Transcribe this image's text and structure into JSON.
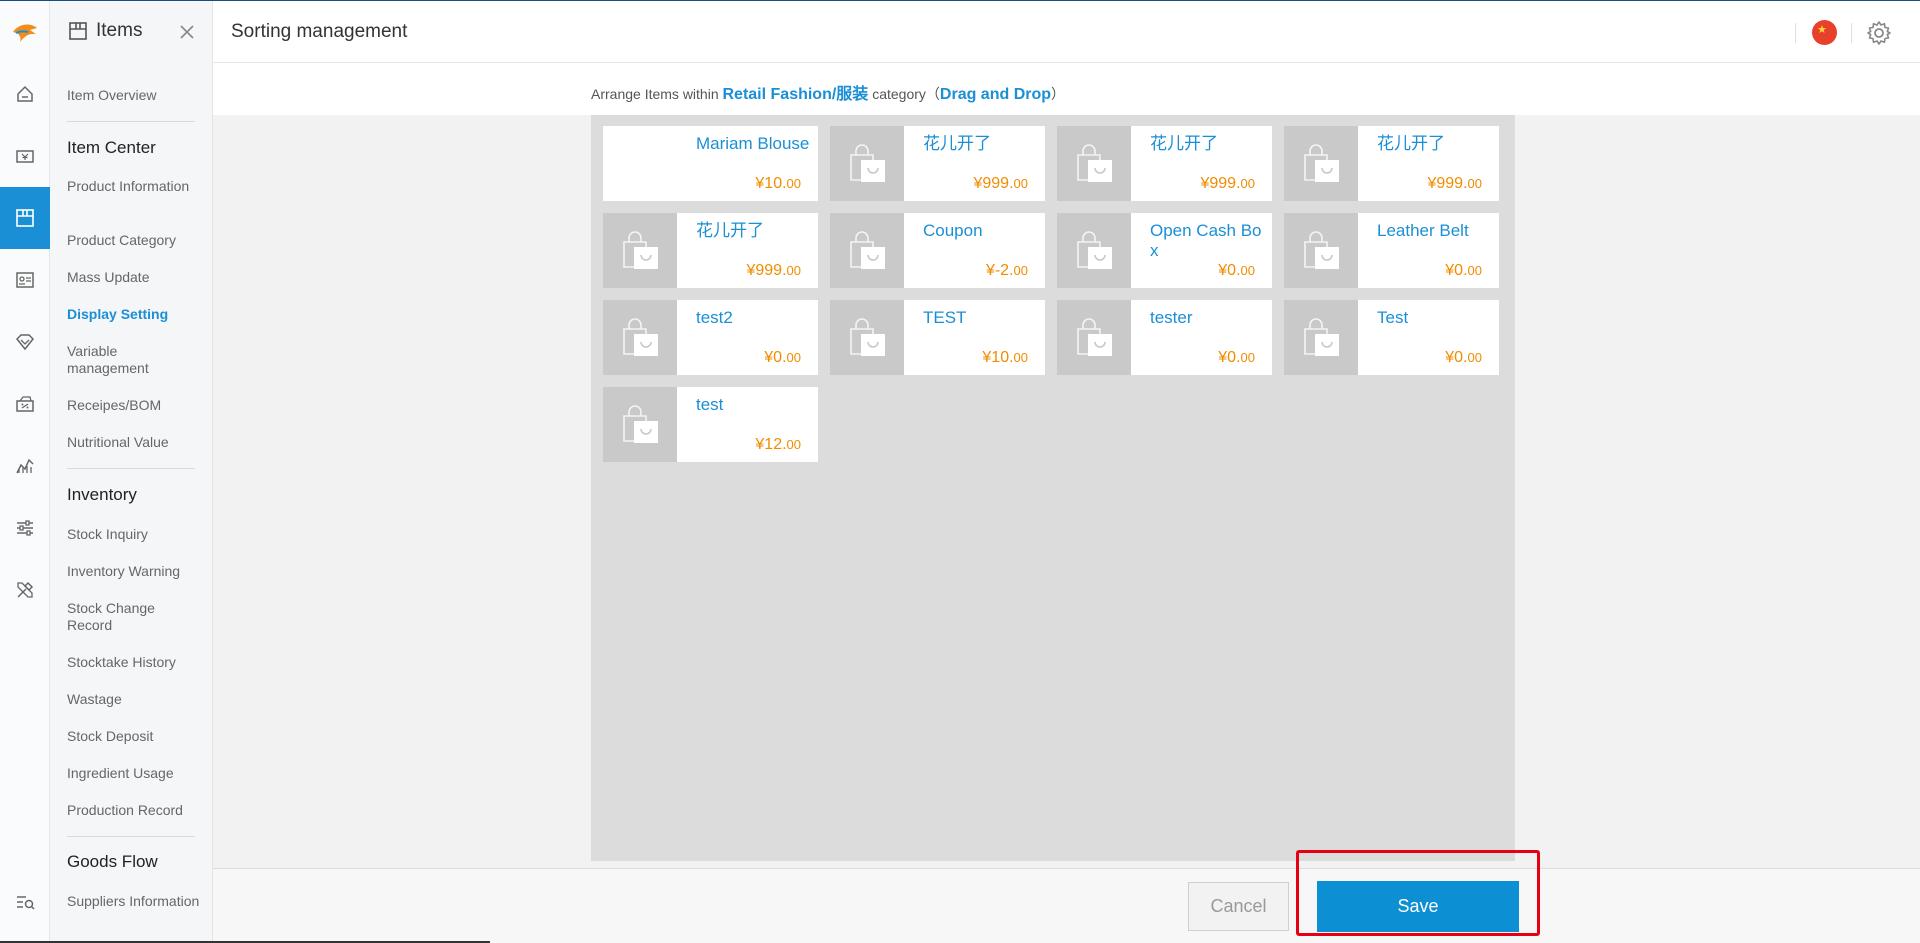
{
  "app": {
    "logo_icon": "app-logo-icon",
    "accent_color": "#1a8fd6",
    "price_color": "#f08c00"
  },
  "rail": [
    {
      "name": "home",
      "icon": "home-icon",
      "active": false
    },
    {
      "name": "sales",
      "icon": "cash-register-icon",
      "active": false
    },
    {
      "name": "items",
      "icon": "box-icon",
      "active": true
    },
    {
      "name": "members",
      "icon": "member-card-icon",
      "active": false
    },
    {
      "name": "marketing",
      "icon": "diamond-icon",
      "active": false
    },
    {
      "name": "promotions",
      "icon": "coupon-icon",
      "active": false
    },
    {
      "name": "reports",
      "icon": "chart-icon",
      "active": false
    },
    {
      "name": "settings",
      "icon": "sliders-icon",
      "active": false
    },
    {
      "name": "tools",
      "icon": "tools-icon",
      "active": false
    },
    {
      "name": "search",
      "icon": "search-list-icon",
      "active": false
    }
  ],
  "subnav": {
    "title": "Items",
    "items": {
      "item_overview": "Item Overview",
      "group_item_center": "Item Center",
      "product_information": "Product Information",
      "product_category": "Product Category",
      "mass_update": "Mass Update",
      "display_setting": "Display Setting",
      "variable_management": "Variable management",
      "receipes_bom": "Receipes/BOM",
      "nutritional_value": "Nutritional Value",
      "group_inventory": "Inventory",
      "stock_inquiry": "Stock Inquiry",
      "inventory_warning": "Inventory Warning",
      "stock_change_record": "Stock Change Record",
      "stocktake_history": "Stocktake History",
      "wastage": "Wastage",
      "stock_deposit": "Stock Deposit",
      "ingredient_usage": "Ingredient Usage",
      "production_record": "Production Record",
      "group_goods_flow": "Goods Flow",
      "suppliers_information": "Suppliers Information"
    }
  },
  "header": {
    "title": "Sorting management",
    "language_flag": "china-flag-icon",
    "settings_icon": "gear-icon"
  },
  "instruction": {
    "prefix": "Arrange Items within ",
    "category": "Retail Fashion/服装",
    "middle": " category（",
    "action": "Drag and Drop",
    "suffix": "）"
  },
  "products": [
    {
      "name": "Mariam Blouse",
      "price_main": "¥10.",
      "price_dec": "00",
      "has_image": false
    },
    {
      "name": "花儿开了",
      "price_main": "¥999.",
      "price_dec": "00",
      "has_image": true
    },
    {
      "name": "花儿开了",
      "price_main": "¥999.",
      "price_dec": "00",
      "has_image": true
    },
    {
      "name": "花儿开了",
      "price_main": "¥999.",
      "price_dec": "00",
      "has_image": true
    },
    {
      "name": "花儿开了",
      "price_main": "¥999.",
      "price_dec": "00",
      "has_image": true
    },
    {
      "name": "Coupon",
      "price_main": "¥-2.",
      "price_dec": "00",
      "has_image": true
    },
    {
      "name": "Open Cash Box",
      "price_main": "¥0.",
      "price_dec": "00",
      "has_image": true
    },
    {
      "name": "Leather Belt",
      "price_main": "¥0.",
      "price_dec": "00",
      "has_image": true
    },
    {
      "name": "test2",
      "price_main": "¥0.",
      "price_dec": "00",
      "has_image": true
    },
    {
      "name": "TEST",
      "price_main": "¥10.",
      "price_dec": "00",
      "has_image": true
    },
    {
      "name": "tester",
      "price_main": "¥0.",
      "price_dec": "00",
      "has_image": true
    },
    {
      "name": "Test",
      "price_main": "¥0.",
      "price_dec": "00",
      "has_image": true
    },
    {
      "name": "test",
      "price_main": "¥12.",
      "price_dec": "00",
      "has_image": true
    }
  ],
  "footer": {
    "cancel_label": "Cancel",
    "save_label": "Save"
  }
}
